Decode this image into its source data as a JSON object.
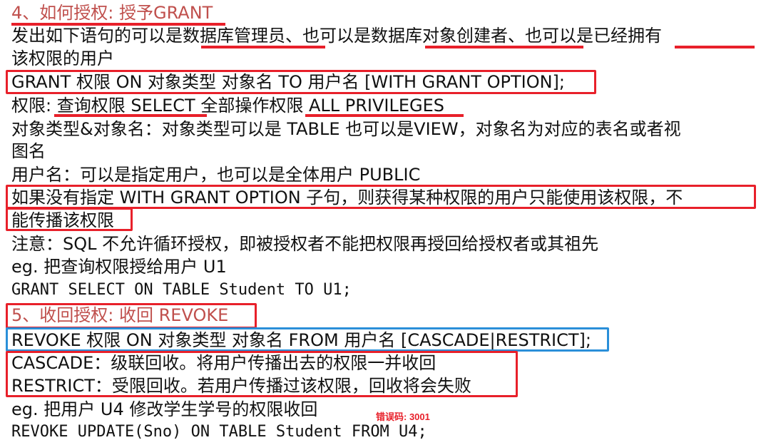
{
  "section4": {
    "heading": "4、如何授权: 授予GRANT",
    "intro_line1": "发出如下语句的可以是数据库管理员、也可以是数据库对象创建者、也可以是已经拥有",
    "intro_line2": "该权限的用户",
    "grant_syntax": "GRANT 权限 ON 对象类型 对象名 TO 用户名 [WITH GRANT OPTION];",
    "privileges": "权限: 查询权限 SELECT 全部操作权限 ALL PRIVILEGES",
    "object_type_line1": "对象类型&对象名：对象类型可以是 TABLE 也可以是VIEW，对象名为对应的表名或者视",
    "object_type_line2": "图名",
    "user_line": "用户名：可以是指定用户，也可以是全体用户 PUBLIC",
    "grant_option_line1": "如果没有指定 WITH GRANT OPTION 子句，则获得某种权限的用户只能使用该权限，不",
    "grant_option_line2": "能传播该权限",
    "note": "注意：SQL 不允许循环授权，即被授权者不能把权限再授回给授权者或其祖先",
    "example_label": "eg. 把查询权限授给用户 U1",
    "example_code": "GRANT SELECT ON TABLE Student TO U1;"
  },
  "section5": {
    "heading": "5、收回授权: 收回 REVOKE",
    "revoke_syntax": "REVOKE 权限 ON 对象类型 对象名 FROM 用户名 [CASCADE|RESTRICT];",
    "cascade": "CASCADE：级联回收。将用户传播出去的权限一并收回",
    "restrict": "RESTRICT：受限回收。若用户传播过该权限，回收将会失败",
    "example_label": "eg. 把用户 U4 修改学生学号的权限收回",
    "example_code": "REVOKE UPDATE(Sno) ON TABLE Student FROM U4;"
  },
  "overlay": {
    "error_code": "错误码: 3001"
  },
  "colors": {
    "heading": "#c0504d",
    "highlight_red": "#e8202a",
    "highlight_blue": "#2a8fd9",
    "text": "#111111"
  }
}
